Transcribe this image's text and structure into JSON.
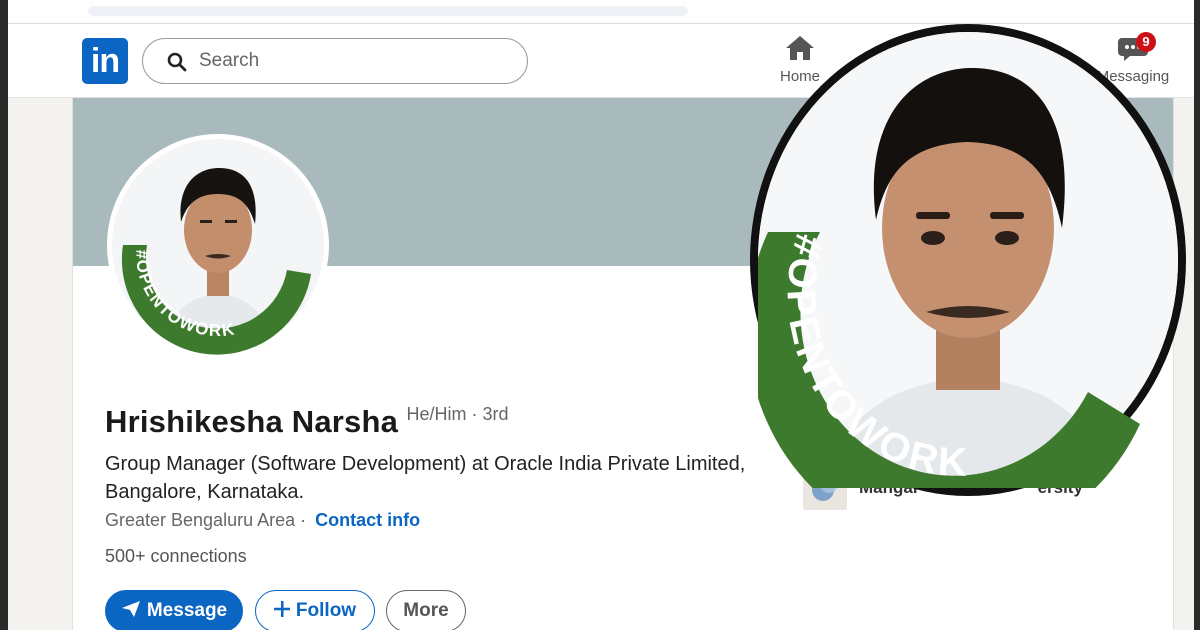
{
  "nav": {
    "logo_text": "in",
    "search_placeholder": "Search",
    "home_label": "Home",
    "messaging_label": "Messaging",
    "messaging_badge": "9"
  },
  "profile": {
    "frame_text": "#OPENTOWORK",
    "name": "Hrishikesha Narsha",
    "pronouns": "He/Him · 3rd",
    "headline": "Group Manager (Software Development) at Oracle India Private Limited, Bangalore, Karnataka.",
    "location": "Greater Bengaluru Area",
    "separator": "·",
    "contact_link": "Contact info",
    "connections": "500+ connections"
  },
  "actions": {
    "message_label": "Message",
    "follow_label": "Follow",
    "more_label": "More"
  },
  "sidebar": {
    "education_label_visible": "Mangal",
    "education_label_tail": "ersity"
  },
  "colors": {
    "brand_blue": "#0a66c2",
    "open_to_work_green": "#3e7a2e",
    "banner": "#a8babc",
    "badge_red": "#cc1016"
  }
}
